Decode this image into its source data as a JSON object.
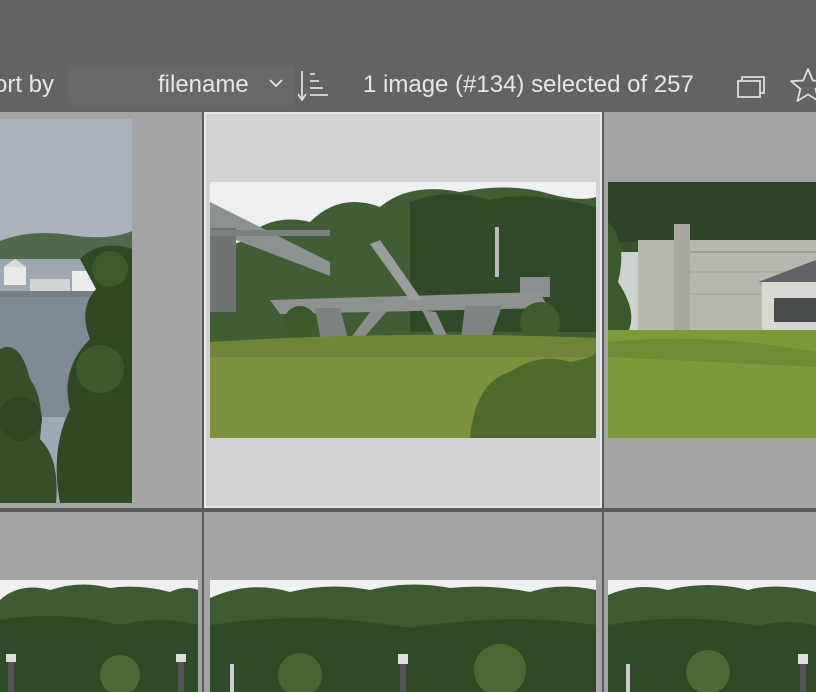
{
  "toolbar": {
    "sort_label": "ort by",
    "sort_value": "filename",
    "sort_order_icon": "sort-ascending-icon",
    "selection_status": "1 image (#134) selected of 257",
    "grouping_icon": "grouping-icon",
    "rating_icon": "star-icon"
  },
  "grid": {
    "selected_image_number": 134,
    "total_images": 257,
    "thumbnails": [
      {
        "scene": "lake-with-white-buildings-and-trees",
        "selected": false
      },
      {
        "scene": "concrete-sculpture-on-lawn-near-bridge",
        "selected": true
      },
      {
        "scene": "dam-wall-and-building-with-lawn",
        "selected": false
      },
      {
        "scene": "forest-treeline-with-lamp-posts",
        "selected": false
      },
      {
        "scene": "forest-treeline-with-lamp-posts",
        "selected": false
      },
      {
        "scene": "forest-treeline-with-lamp-posts",
        "selected": false
      }
    ]
  },
  "colors": {
    "toolbar_bg": "#636363",
    "cell_bg": "#a4a4a4",
    "selected_cell_bg": "#d2d2d2",
    "text": "#e6e6e6"
  }
}
